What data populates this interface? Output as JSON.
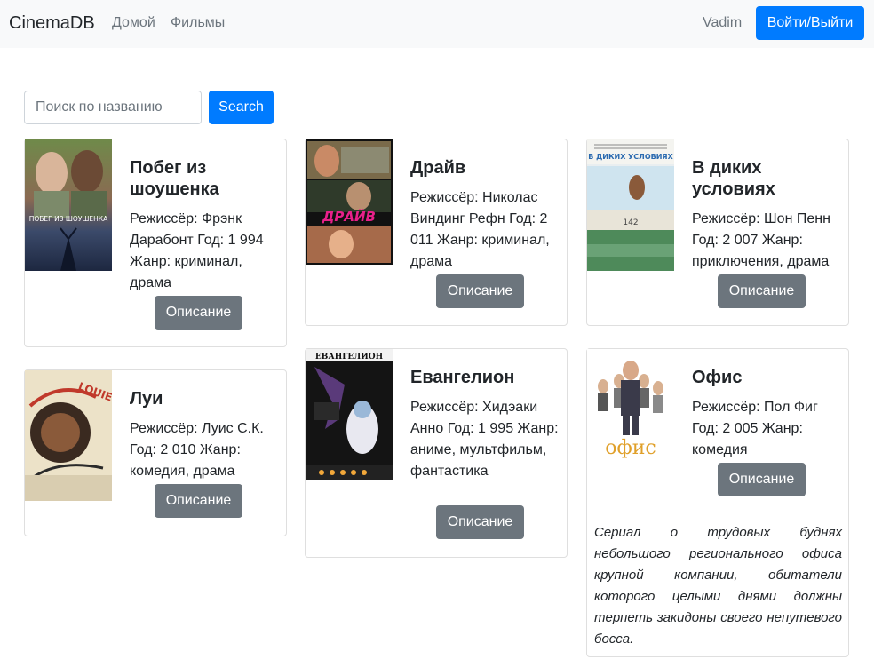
{
  "nav": {
    "brand": "CinemaDB",
    "home": "Домой",
    "films": "Фильмы",
    "user": "Vadim",
    "login": "Войти/Выйти"
  },
  "search": {
    "placeholder": "Поиск по названию",
    "button": "Search"
  },
  "movies": [
    {
      "title": "Побег из шоушенка",
      "info": "Режиссёр: Фрэнк Дарабонт Год: 1 994 Жанр: криминал, драма",
      "button": "Описание",
      "poster_text": "ПОБЕГ ИЗ ШОУШЕНКА"
    },
    {
      "title": "Драйв",
      "info": "Режиссёр: Николас Виндинг Рефн Год: 2 011 Жанр: криминал, драма",
      "button": "Описание",
      "poster_text": "ДРАЙВ"
    },
    {
      "title": "В диких условиях",
      "info": "Режиссёр: Шон Пенн Год: 2 007 Жанр: приключения, драма",
      "button": "Описание",
      "poster_text": "В ДИКИХ УСЛОВИЯХ"
    },
    {
      "title": "Луи",
      "info": "Режиссёр: Луис С.К. Год: 2 010 Жанр: комедия, драма",
      "button": "Описание",
      "poster_text": "LOUIE"
    },
    {
      "title": "Евангелион",
      "info": "Режиссёр: Хидэаки Анно Год: 1 995 Жанр: аниме, мультфильм, фантастика",
      "button": "Описание",
      "poster_text": "ЕВАНГЕЛИОН"
    },
    {
      "title": "Офис",
      "info": "Режиссёр: Пол Фиг Год: 2 005 Жанр: комедия",
      "button": "Описание",
      "poster_text": "офис",
      "description": "Сериал о трудовых буднях небольшого регионального офиса крупной компании, обитатели которого целыми днями должны терпеть закидоны своего непутевого босса."
    }
  ],
  "colors": {
    "primary": "#007bff",
    "secondary": "#6c757d",
    "navbar_bg": "#f8f9fa"
  }
}
